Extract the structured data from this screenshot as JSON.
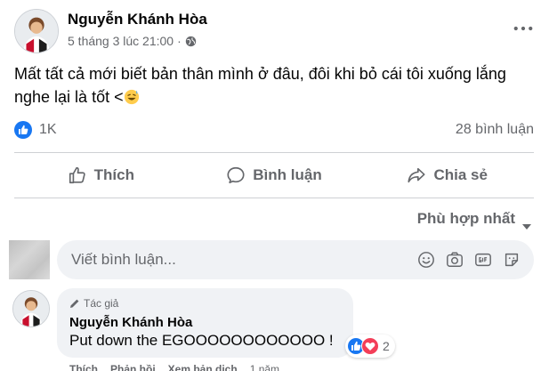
{
  "post": {
    "author": "Nguyễn Khánh Hòa",
    "timestamp": "5 tháng 3 lúc 21:00",
    "separator": "·",
    "text": "Mất tất cả mới biết bản thân mình ở đâu, đôi khi bỏ cái tôi xuống lắng nghe lại là tốt <",
    "emoji": "grinning-sweat-emoji"
  },
  "stats": {
    "likes": "1K",
    "comments": "28 bình luận"
  },
  "actions": {
    "like_label": "Thích",
    "comment_label": "Bình luận",
    "share_label": "Chia sẻ"
  },
  "sort": {
    "label": "Phù hợp nhất"
  },
  "comment_box": {
    "placeholder": "Viết bình luận..."
  },
  "comment": {
    "badge": "Tác giả",
    "author": "Nguyễn Khánh Hòa",
    "text": "Put down the EGOOOOOOOOOOOO !",
    "reaction_count": "2",
    "actions": {
      "like": "Thích",
      "reply": "Phản hồi",
      "translate": "Xem bản dịch",
      "time": "1 năm"
    }
  },
  "colors": {
    "primary_text": "#050505",
    "secondary_text": "#65676b",
    "like_blue": "#1877f2",
    "love_red": "#f33e58",
    "bubble_bg": "#f0f2f5"
  }
}
